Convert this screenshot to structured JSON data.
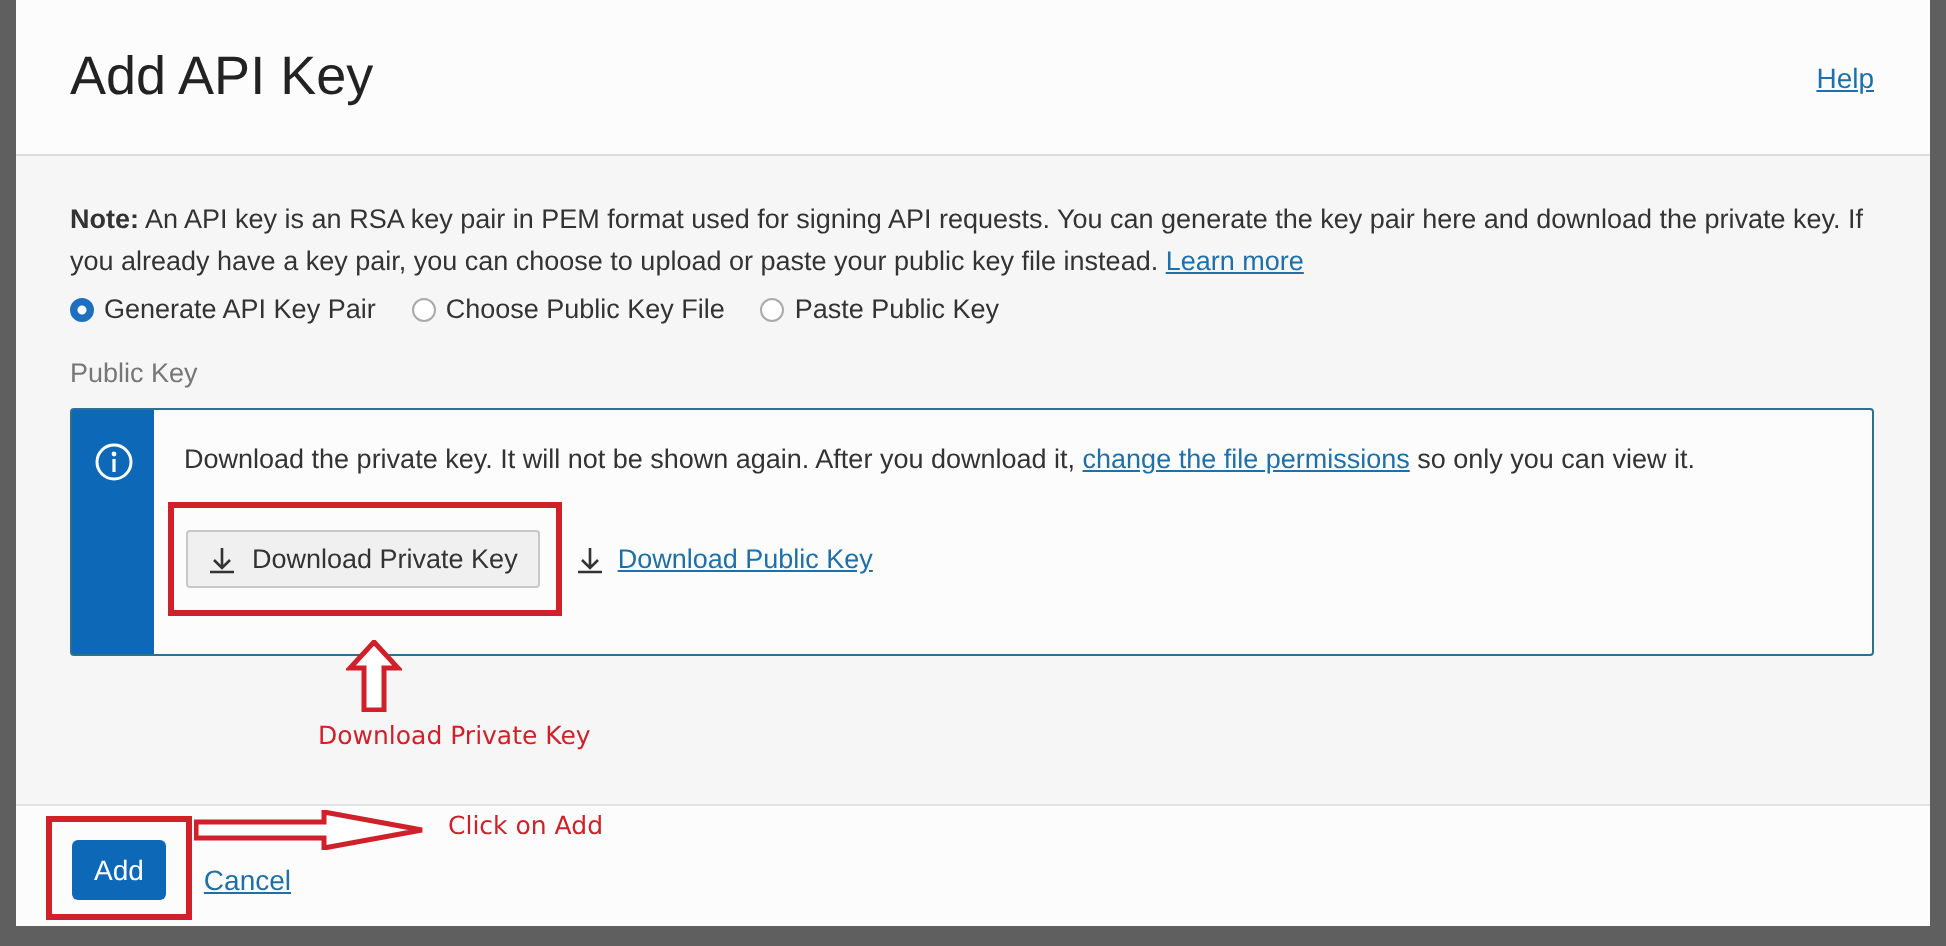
{
  "dialog": {
    "title": "Add API Key",
    "help_link": "Help",
    "note": {
      "label": "Note:",
      "text": "An API key is an RSA key pair in PEM format used for signing API requests. You can generate the key pair here and download the private key. If you already have a key pair, you can choose to upload or paste your public key file instead.",
      "link": "Learn more"
    },
    "options": [
      {
        "label": "Generate API Key Pair",
        "selected": true
      },
      {
        "label": "Choose Public Key File",
        "selected": false
      },
      {
        "label": "Paste Public Key",
        "selected": false
      }
    ],
    "section_label": "Public Key",
    "info": {
      "text_before": "Download the private key. It will not be shown again. After you download it,",
      "link": "change the file permissions",
      "text_after": "so only you can view it."
    },
    "download_private_button": "Download Private Key",
    "download_public_link": "Download Public Key",
    "buttons": {
      "add": "Add",
      "cancel": "Cancel"
    }
  },
  "annotations": {
    "download": "Download Private Key",
    "add": "Click on Add"
  }
}
